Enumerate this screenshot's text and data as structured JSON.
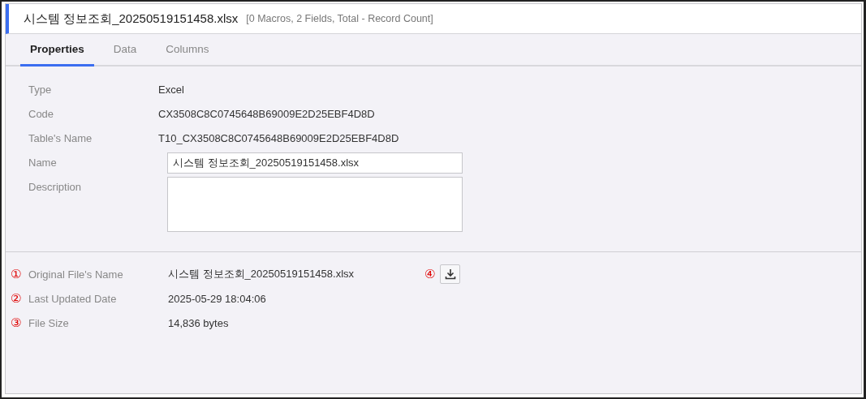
{
  "header": {
    "title": "시스템 정보조회_20250519151458.xlsx",
    "summary": "[0 Macros, 2 Fields, Total - Record Count]"
  },
  "tabs": [
    {
      "label": "Properties",
      "selected": true
    },
    {
      "label": "Data",
      "selected": false
    },
    {
      "label": "Columns",
      "selected": false
    }
  ],
  "properties": [
    {
      "kind": "text",
      "label": "Type",
      "value": "Excel"
    },
    {
      "kind": "text",
      "label": "Code",
      "value": "CX3508C8C0745648B69009E2D25EBF4D8D"
    },
    {
      "kind": "text",
      "label": "Table's Name",
      "value": "T10_CX3508C8C0745648B69009E2D25EBF4D8D"
    },
    {
      "kind": "input",
      "label": "Name",
      "value": "시스템 정보조회_20250519151458.xlsx"
    },
    {
      "kind": "textarea",
      "label": "Description"
    }
  ],
  "file_info": [
    {
      "marker": "①",
      "label": "Original File's Name",
      "value": "시스템 정보조회_20250519151458.xlsx",
      "download_marker": "④"
    },
    {
      "marker": "②",
      "label": "Last Updated Date",
      "value": "2025-05-29 18:04:06"
    },
    {
      "marker": "③",
      "label": "File Size",
      "value": "14,836 bytes"
    }
  ]
}
